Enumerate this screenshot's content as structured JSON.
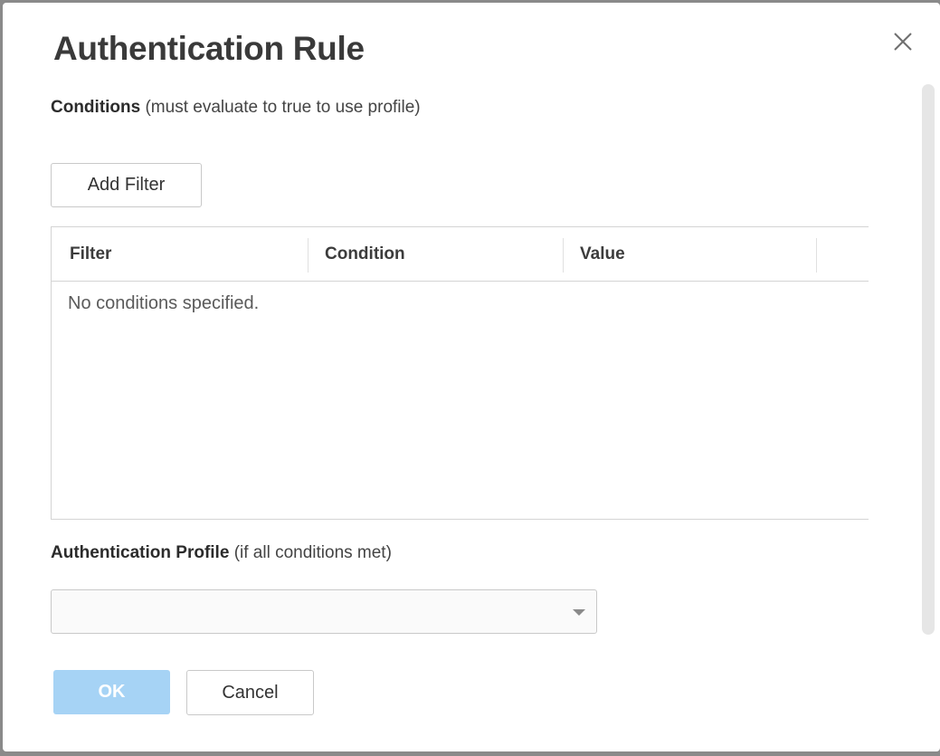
{
  "dialog": {
    "title": "Authentication Rule",
    "close_icon": "close-icon"
  },
  "conditions": {
    "label_bold": "Conditions",
    "label_suffix": "(must evaluate to true to use profile)",
    "add_filter_label": "Add Filter",
    "table": {
      "columns": [
        "Filter",
        "Condition",
        "Value"
      ],
      "rows": [],
      "empty_message": "No conditions specified."
    }
  },
  "profile": {
    "label_bold": "Authentication Profile",
    "label_suffix": "(if all conditions met)",
    "selected_value": "",
    "dropdown_icon": "chevron-down-icon"
  },
  "footer": {
    "ok_label": "OK",
    "cancel_label": "Cancel",
    "ok_color": "#a6d3f5"
  }
}
